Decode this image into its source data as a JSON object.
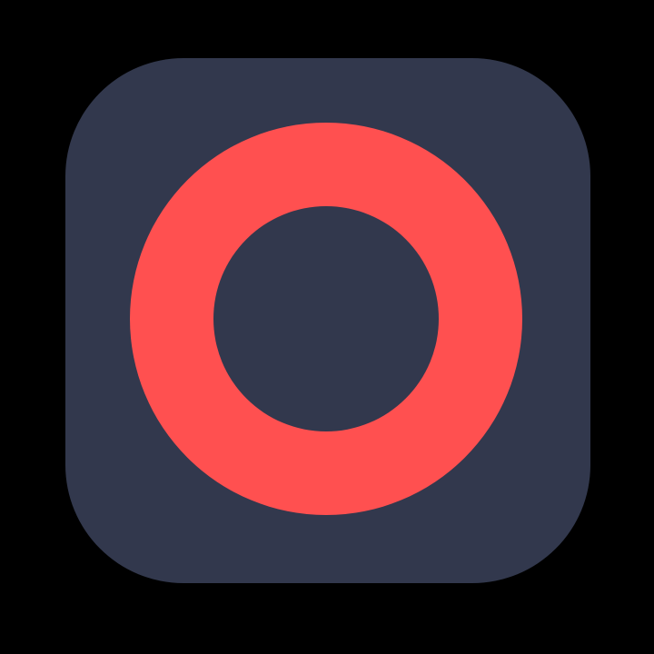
{
  "icon": {
    "name": "ring-app-icon",
    "colors": {
      "background": "#000000",
      "tile": "#32384d",
      "ring": "#ff5050",
      "center": "#32384d"
    }
  }
}
